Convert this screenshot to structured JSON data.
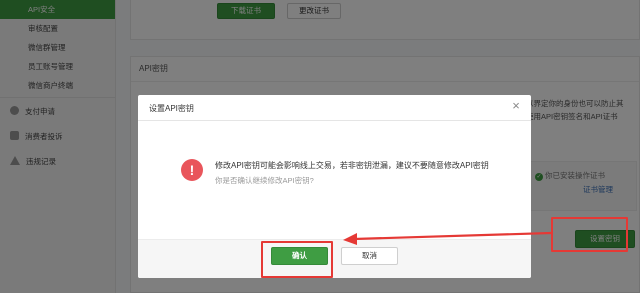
{
  "sidebar": {
    "items": [
      {
        "label": "API安全",
        "active": true
      },
      {
        "label": "审核配置"
      },
      {
        "label": "微信群管理"
      },
      {
        "label": "员工账号管理"
      },
      {
        "label": "微信商户终端"
      }
    ],
    "groups": [
      {
        "label": "支付申请",
        "icon": "circle-icon"
      },
      {
        "label": "消费者投诉",
        "icon": "chat-bubble-icon"
      },
      {
        "label": "违规记录",
        "icon": "warning-triangle-icon"
      }
    ]
  },
  "certificate": {
    "download_label": "下载证书",
    "change_label": "更改证书"
  },
  "api_key": {
    "section_title": "API密钥",
    "right_lines": [
      "以界定你的身份也可以防止其",
      "使用API密钥签名和API证书"
    ],
    "installed_text": "你已安装操作证书",
    "cert_manage_link": "证书管理",
    "set_key_button": "设置密钥"
  },
  "modal": {
    "title": "设置API密钥",
    "close_icon": "close-icon",
    "warning_icon": "exclamation-icon",
    "message": "修改API密钥可能会影响线上交易，若非密钥泄漏，建议不要随意修改API密钥",
    "sub_message": "你是否确认继续修改API密钥?",
    "confirm_label": "确认",
    "cancel_label": "取消"
  },
  "colors": {
    "brand_green": "#3f9d43",
    "annotation_red": "#e53935",
    "warning_red": "#e9555b",
    "link_blue": "#3a6fb7"
  }
}
